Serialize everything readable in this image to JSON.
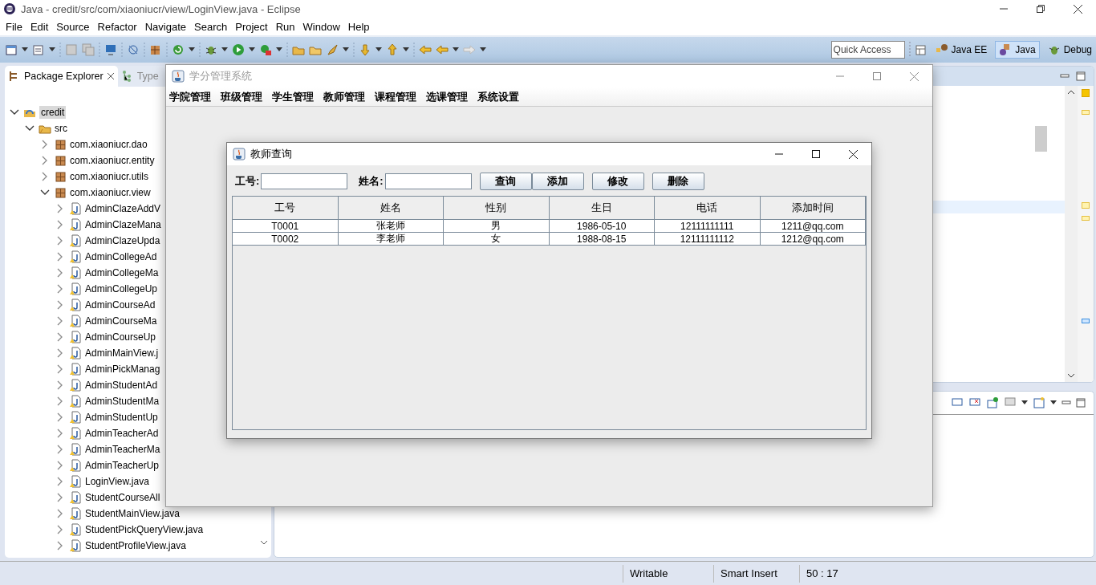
{
  "window": {
    "title": "Java - credit/src/com/xiaoniucr/view/LoginView.java - Eclipse"
  },
  "menu": [
    "File",
    "Edit",
    "Source",
    "Refactor",
    "Navigate",
    "Search",
    "Project",
    "Run",
    "Window",
    "Help"
  ],
  "quick_access": {
    "placeholder": "Quick Access"
  },
  "perspectives": [
    {
      "label": "Java EE",
      "selected": false
    },
    {
      "label": "Java",
      "selected": true
    },
    {
      "label": "Debug",
      "selected": false
    }
  ],
  "view_tabs": [
    {
      "label": "Package Explorer",
      "selected": true
    },
    {
      "label": "Type",
      "selected": false
    }
  ],
  "tree": [
    {
      "label": "credit",
      "kind": "project",
      "expanded": true,
      "selected": true,
      "children": [
        {
          "label": "src",
          "kind": "folder",
          "expanded": true,
          "selected": false,
          "children": [
            {
              "label": "com.xiaoniucr.dao",
              "kind": "package",
              "expanded": false,
              "selected": false
            },
            {
              "label": "com.xiaoniucr.entity",
              "kind": "package",
              "expanded": false,
              "selected": false
            },
            {
              "label": "com.xiaoniucr.utils",
              "kind": "package",
              "expanded": false,
              "selected": false
            },
            {
              "label": "com.xiaoniucr.view",
              "kind": "package",
              "expanded": true,
              "selected": false,
              "children": [
                {
                  "label": "AdminClazeAddV",
                  "kind": "file",
                  "expanded": false,
                  "selected": false
                },
                {
                  "label": "AdminClazeMana",
                  "kind": "file",
                  "expanded": false,
                  "selected": false
                },
                {
                  "label": "AdminClazeUpda",
                  "kind": "file",
                  "expanded": false,
                  "selected": false
                },
                {
                  "label": "AdminCollegeAd",
                  "kind": "file",
                  "expanded": false,
                  "selected": false
                },
                {
                  "label": "AdminCollegeMa",
                  "kind": "file",
                  "expanded": false,
                  "selected": false
                },
                {
                  "label": "AdminCollegeUp",
                  "kind": "file",
                  "expanded": false,
                  "selected": false
                },
                {
                  "label": "AdminCourseAd",
                  "kind": "file",
                  "expanded": false,
                  "selected": false
                },
                {
                  "label": "AdminCourseMa",
                  "kind": "file",
                  "expanded": false,
                  "selected": false
                },
                {
                  "label": "AdminCourseUp",
                  "kind": "file",
                  "expanded": false,
                  "selected": false
                },
                {
                  "label": "AdminMainView.j",
                  "kind": "file",
                  "expanded": false,
                  "selected": false
                },
                {
                  "label": "AdminPickManag",
                  "kind": "file",
                  "expanded": false,
                  "selected": false
                },
                {
                  "label": "AdminStudentAd",
                  "kind": "file",
                  "expanded": false,
                  "selected": false
                },
                {
                  "label": "AdminStudentMa",
                  "kind": "file",
                  "expanded": false,
                  "selected": false
                },
                {
                  "label": "AdminStudentUp",
                  "kind": "file",
                  "expanded": false,
                  "selected": false
                },
                {
                  "label": "AdminTeacherAd",
                  "kind": "file",
                  "expanded": false,
                  "selected": false
                },
                {
                  "label": "AdminTeacherMa",
                  "kind": "file",
                  "expanded": false,
                  "selected": false
                },
                {
                  "label": "AdminTeacherUp",
                  "kind": "file",
                  "expanded": false,
                  "selected": false
                },
                {
                  "label": "LoginView.java",
                  "kind": "file",
                  "expanded": false,
                  "selected": false
                },
                {
                  "label": "StudentCourseAll",
                  "kind": "file",
                  "expanded": false,
                  "selected": false
                },
                {
                  "label": "StudentMainView.java",
                  "kind": "file",
                  "expanded": false,
                  "selected": false
                },
                {
                  "label": "StudentPickQueryView.java",
                  "kind": "file",
                  "expanded": false,
                  "selected": false
                },
                {
                  "label": "StudentProfileView.java",
                  "kind": "file",
                  "expanded": false,
                  "selected": false
                }
              ]
            }
          ]
        }
      ]
    }
  ],
  "status_bar": [
    "Writable",
    "Smart Insert",
    "50 : 17"
  ],
  "app_window": {
    "title": "学分管理系统",
    "active": false,
    "menu": [
      "学院管理",
      "班级管理",
      "学生管理",
      "教师管理",
      "课程管理",
      "选课管理",
      "系统设置"
    ]
  },
  "dialog": {
    "title": "教师查询",
    "active": true,
    "fields": [
      {
        "label": "工号:"
      },
      {
        "label": "姓名:"
      }
    ],
    "search_button": "查询",
    "actions": [
      "添加",
      "修改",
      "删除"
    ],
    "table": {
      "columns": [
        "工号",
        "姓名",
        "性别",
        "生日",
        "电话",
        "添加时间"
      ],
      "rows": [
        [
          "T0001",
          "张老师",
          "男",
          "1986-05-10",
          "12111111111",
          "1211@qq.com"
        ],
        [
          "T0002",
          "李老师",
          "女",
          "1988-08-15",
          "12111111112",
          "1212@qq.com"
        ]
      ]
    }
  }
}
